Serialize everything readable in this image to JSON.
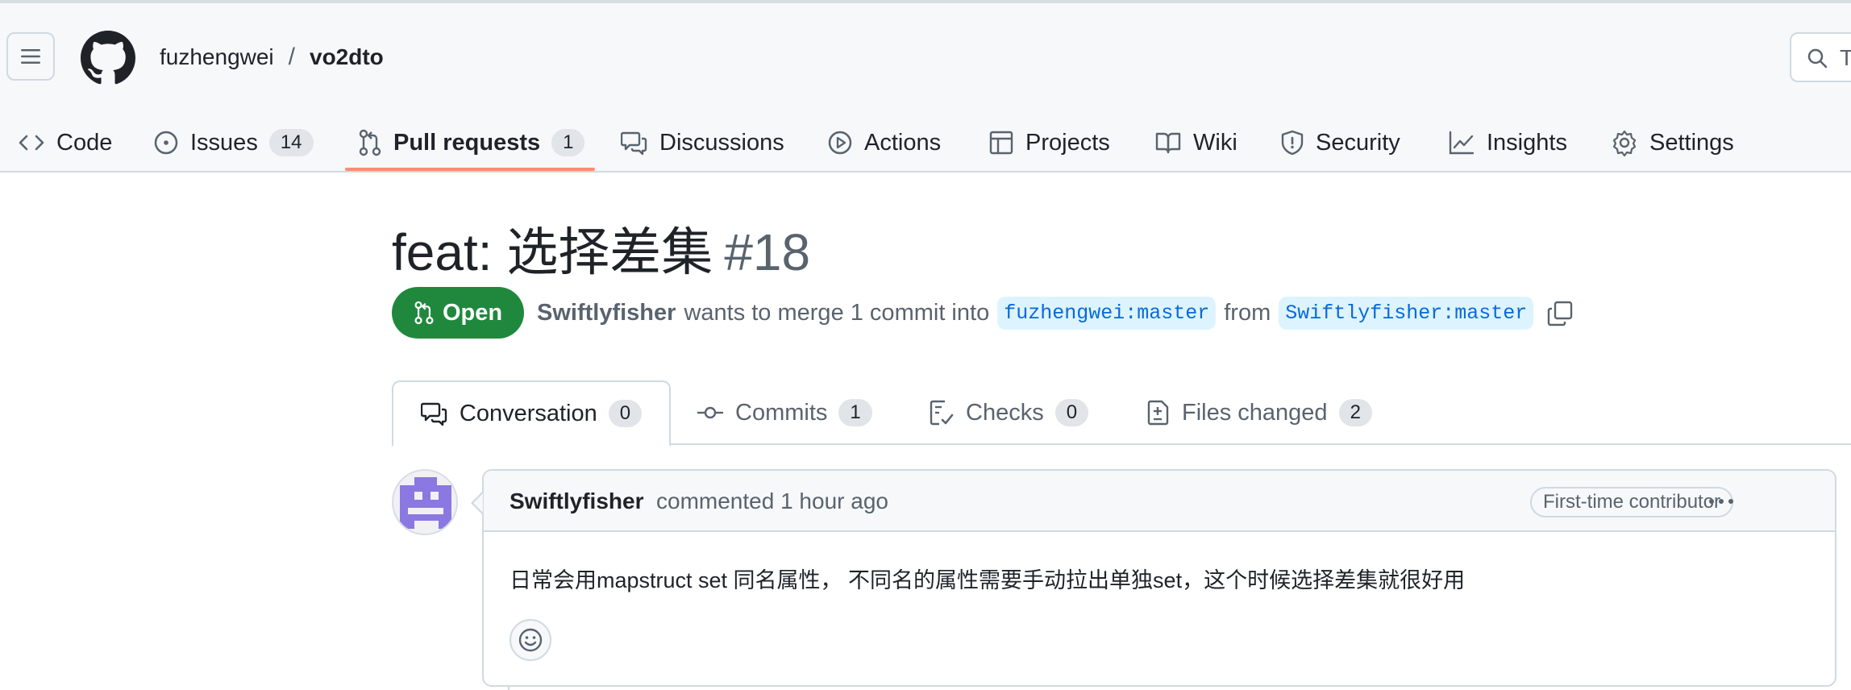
{
  "header": {
    "owner": "fuzhengwei",
    "separator": "/",
    "repo": "vo2dto",
    "search_placeholder": "T"
  },
  "nav": {
    "tabs": [
      {
        "label": "Code",
        "icon": "code-icon"
      },
      {
        "label": "Issues",
        "icon": "issue-icon",
        "count": "14"
      },
      {
        "label": "Pull requests",
        "icon": "pull-request-icon",
        "count": "1",
        "active": true
      },
      {
        "label": "Discussions",
        "icon": "discussion-icon"
      },
      {
        "label": "Actions",
        "icon": "play-icon"
      },
      {
        "label": "Projects",
        "icon": "table-icon"
      },
      {
        "label": "Wiki",
        "icon": "book-icon"
      },
      {
        "label": "Security",
        "icon": "shield-icon"
      },
      {
        "label": "Insights",
        "icon": "graph-icon"
      },
      {
        "label": "Settings",
        "icon": "gear-icon"
      }
    ]
  },
  "pr": {
    "title": "feat: 选择差集",
    "number": "#18",
    "state": "Open",
    "author": "Swiftlyfisher",
    "merge_text": "wants to merge 1 commit into",
    "base_branch": "fuzhengwei:master",
    "from_text": "from",
    "head_branch": "Swiftlyfisher:master"
  },
  "pr_tabs": [
    {
      "label": "Conversation",
      "count": "0",
      "icon": "comment-discussion-icon"
    },
    {
      "label": "Commits",
      "count": "1",
      "icon": "commit-icon"
    },
    {
      "label": "Checks",
      "count": "0",
      "icon": "checklist-icon"
    },
    {
      "label": "Files changed",
      "count": "2",
      "icon": "file-diff-icon"
    }
  ],
  "comment": {
    "author": "Swiftlyfisher",
    "action": "commented 1 hour ago",
    "badge": "First-time contributor",
    "body": "日常会用mapstruct set 同名属性， 不同名的属性需要手动拉出单独set，这个时候选择差集就很好用"
  },
  "colors": {
    "open_green": "#1f883d",
    "branch_bg": "#ddf4ff",
    "branch_fg": "#0969da",
    "active_underline": "#fd8c73",
    "avatar_purple": "#8b78e0"
  }
}
